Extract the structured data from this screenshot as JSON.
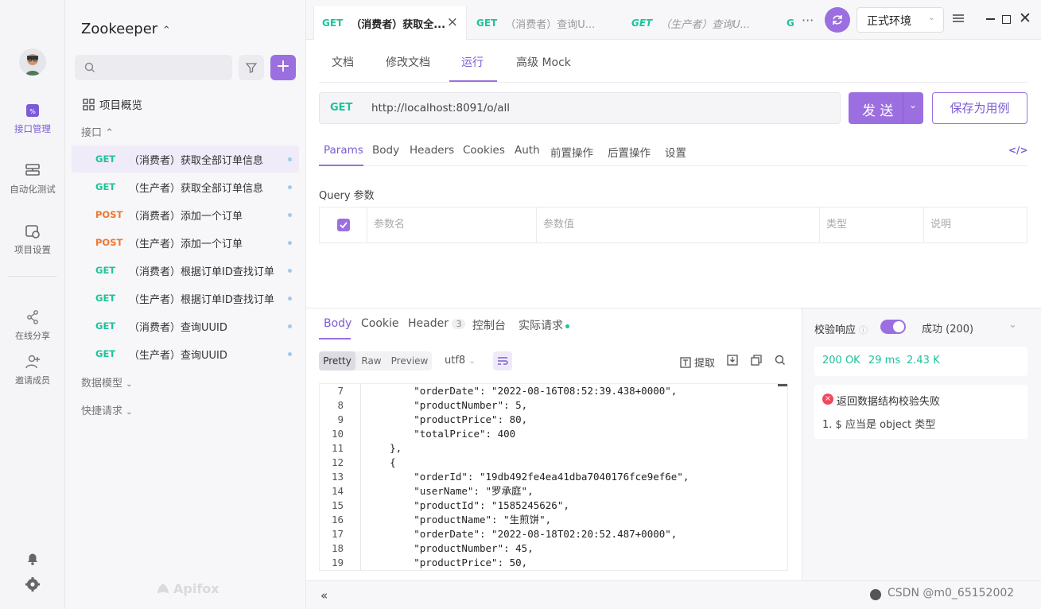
{
  "rail": {
    "items": [
      {
        "label": "接口管理",
        "icon": "api-icon"
      },
      {
        "label": "自动化测试",
        "icon": "automation-icon"
      },
      {
        "label": "项目设置",
        "icon": "settings-icon"
      },
      {
        "label": "在线分享",
        "icon": "share-icon"
      },
      {
        "label": "邀请成员",
        "icon": "add-user-icon"
      }
    ]
  },
  "sidebar": {
    "project_name": "Zookeeper",
    "overview_label": "项目概览",
    "group_label": "接口",
    "items": [
      {
        "method": "GET",
        "name": "（消费者）获取全部订单信息"
      },
      {
        "method": "GET",
        "name": "（生产者）获取全部订单信息"
      },
      {
        "method": "POST",
        "name": "（消费者）添加一个订单"
      },
      {
        "method": "POST",
        "name": "（生产者）添加一个订单"
      },
      {
        "method": "GET",
        "name": "（消费者）根据订单ID查找订单"
      },
      {
        "method": "GET",
        "name": "（生产者）根据订单ID查找订单"
      },
      {
        "method": "GET",
        "name": "（消费者）查询UUID"
      },
      {
        "method": "GET",
        "name": "（生产者）查询UUID"
      }
    ],
    "data_model_label": "数据模型",
    "quick_request_label": "快捷请求",
    "watermark": "Apifox"
  },
  "tabs": [
    {
      "method": "GET",
      "title": "（消费者）获取全..."
    },
    {
      "method": "GET",
      "title": "（消费者）查询U..."
    },
    {
      "method": "GET",
      "title": "（生产者）查询U..."
    },
    {
      "method": "G",
      "title": ""
    }
  ],
  "environment": "正式环境",
  "subtabs": [
    "文档",
    "修改文档",
    "运行",
    "高级 Mock"
  ],
  "request": {
    "method": "GET",
    "url": "http://localhost:8091/o/all",
    "send_label": "发 送",
    "save_label": "保存为用例"
  },
  "param_tabs": [
    "Params",
    "Body",
    "Headers",
    "Cookies",
    "Auth",
    "前置操作",
    "后置操作",
    "设置"
  ],
  "query": {
    "title": "Query 参数",
    "columns": [
      "参数名",
      "参数值",
      "类型",
      "说明"
    ]
  },
  "response": {
    "tabs": [
      "Body",
      "Cookie",
      "Header",
      "控制台",
      "实际请求"
    ],
    "header_count": "3",
    "formats": [
      "Pretty",
      "Raw",
      "Preview"
    ],
    "encoding": "utf8",
    "extract_label": "提取",
    "lines": [
      {
        "n": "7",
        "text": "        \"orderDate\": \"2022-08-16T08:52:39.438+0000\","
      },
      {
        "n": "8",
        "text": "        \"productNumber\": 5,"
      },
      {
        "n": "9",
        "text": "        \"productPrice\": 80,"
      },
      {
        "n": "10",
        "text": "        \"totalPrice\": 400"
      },
      {
        "n": "11",
        "text": "    },"
      },
      {
        "n": "12",
        "text": "    {"
      },
      {
        "n": "13",
        "text": "        \"orderId\": \"19db492fe4ea41dba7040176fce9ef6e\","
      },
      {
        "n": "14",
        "text": "        \"userName\": \"罗承庭\","
      },
      {
        "n": "15",
        "text": "        \"productId\": \"1585245626\","
      },
      {
        "n": "16",
        "text": "        \"productName\": \"生煎饼\","
      },
      {
        "n": "17",
        "text": "        \"orderDate\": \"2022-08-18T02:20:52.487+0000\","
      },
      {
        "n": "18",
        "text": "        \"productNumber\": 45,"
      },
      {
        "n": "19",
        "text": "        \"productPrice\": 50,"
      }
    ]
  },
  "validation": {
    "label": "校验响应",
    "result": "成功 (200)",
    "status": "200 OK",
    "time": "29 ms",
    "size": "2.43 K",
    "error_title": "返回数据结构校验失败",
    "error_detail": "1. $ 应当是 object 类型"
  },
  "footer": {
    "watermark": "CSDN @m0_65152002"
  },
  "colors": {
    "accent": "#9b6fe0",
    "get": "#1ec29b",
    "post": "#f0762f"
  }
}
